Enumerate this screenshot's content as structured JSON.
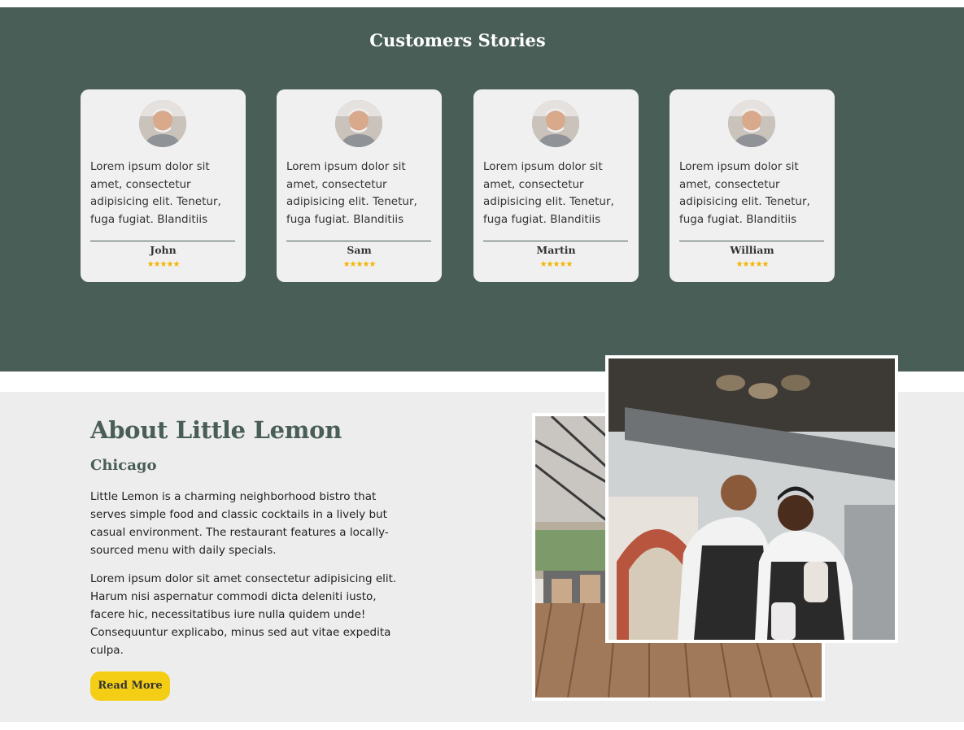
{
  "stories": {
    "title": "Customers Stories",
    "testimonials": [
      {
        "text": "Lorem ipsum dolor sit amet, consectetur adipisicing elit. Tenetur, fuga fugiat. Blanditiis",
        "name": "John",
        "rating": 5
      },
      {
        "text": "Lorem ipsum dolor sit amet, consectetur adipisicing elit. Tenetur, fuga fugiat. Blanditiis",
        "name": "Sam",
        "rating": 5
      },
      {
        "text": "Lorem ipsum dolor sit amet, consectetur adipisicing elit. Tenetur, fuga fugiat. Blanditiis",
        "name": "Martin",
        "rating": 5
      },
      {
        "text": "Lorem ipsum dolor sit amet, consectetur adipisicing elit. Tenetur, fuga fugiat. Blanditiis",
        "name": "William",
        "rating": 5
      }
    ],
    "stars": "★★★★★"
  },
  "about": {
    "title": "About Little Lemon",
    "subtitle": "Chicago",
    "paragraph1": "Little Lemon is a charming neighborhood bistro that serves simple food and classic cocktails in a lively but casual environment. The restaurant features a locally-sourced menu with daily specials.",
    "paragraph2": "Lorem ipsum dolor sit amet consectetur adipisicing elit. Harum nisi aspernatur commodi dicta deleniti iusto, facere hic, necessitatibus iure nulla quidem unde! Consequuntur explicabo, minus sed aut vitae expedita culpa.",
    "read_more_label": "Read More"
  },
  "colors": {
    "primary_green": "#495e57",
    "accent_yellow": "#f4ce14",
    "card_bg": "#f0f0f0",
    "star": "#f4b400"
  }
}
